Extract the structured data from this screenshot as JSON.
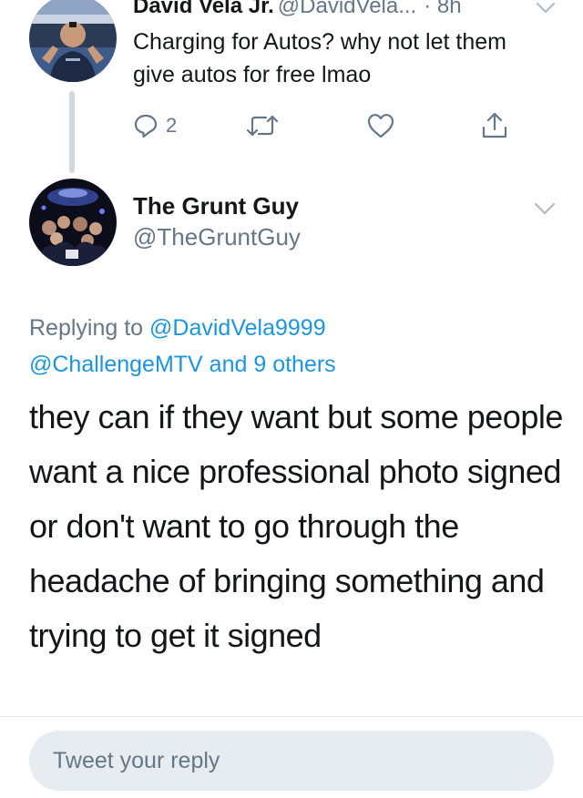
{
  "parent_tweet": {
    "name": "David Vela Jr.",
    "handle": "@DavidVela...",
    "time": "· 8h",
    "text": "Charging for Autos? why not let them give autos for free lmao",
    "reply_count": "2",
    "icons": {
      "avatar": "user-avatar",
      "menu": "chevron-down-icon",
      "reply": "reply-icon",
      "retweet": "retweet-icon",
      "like": "heart-icon",
      "share": "share-icon"
    }
  },
  "main_tweet": {
    "name": "The Grunt Guy",
    "handle": "@TheGruntGuy",
    "replying_prefix": "Replying to",
    "replying_mention_1": "@DavidVela9999",
    "replying_mention_2": "@ChallengeMTV and 9 others",
    "text": "they can if they want but some people want a nice professional photo signed or don't want to go through the headache of bringing something and trying to get it signed",
    "icons": {
      "avatar": "user-avatar",
      "menu": "chevron-down-icon"
    }
  },
  "reply_box": {
    "placeholder": "Tweet your reply"
  },
  "colors": {
    "link": "#1b95e0",
    "secondary_text": "#657786",
    "primary_text": "#14171a",
    "input_background": "#e6ecf0"
  }
}
